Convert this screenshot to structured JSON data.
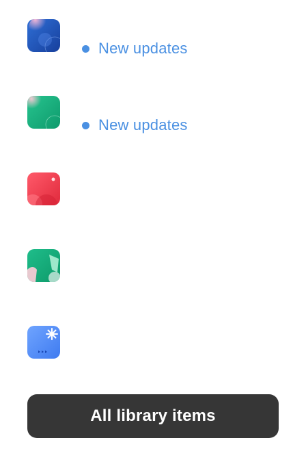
{
  "colors": {
    "status_text": "#4a90e2",
    "status_dot": "#4a90e2",
    "button_bg": "#363636",
    "button_text": "#ffffff"
  },
  "items": [
    {
      "icon": "blue-artwork-thumbnail-icon",
      "status": "New updates"
    },
    {
      "icon": "green-artwork-thumbnail-icon",
      "status": "New updates"
    },
    {
      "icon": "red-artwork-thumbnail-icon",
      "status": ""
    },
    {
      "icon": "green-abstract-thumbnail-icon",
      "status": ""
    },
    {
      "icon": "blue-sparkle-thumbnail-icon",
      "status": ""
    }
  ],
  "footer": {
    "all_items_label": "All library items"
  }
}
